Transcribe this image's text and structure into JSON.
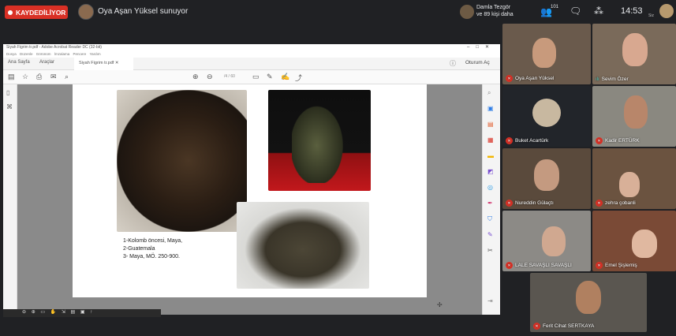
{
  "topbar": {
    "recording_label": "KAYDEDİLİYOR",
    "presenter_text": "Oya Aşan Yüksel sunuyor",
    "viewer_name": "Damla Tezgör",
    "viewer_others": "ve 89 kişi daha",
    "participant_count": "101",
    "clock": "14:53",
    "self_label": "Siz"
  },
  "acrobat": {
    "window_title": "Siyah Figrim tr.pdf - Adobe Acrobat Reader DC (32-bit)",
    "menu": "Dosya Düzenle Görünüm İmzalama Pencere Yardım",
    "tab_home": "Ana Sayfa",
    "tab_tools": "Araçlar",
    "tab_file": "Siyah Figrim tr.pdf",
    "signin": "Oturum Aç",
    "page_indicator": "/4 / 60"
  },
  "slide": {
    "caption_lines": [
      "1-Kolomb öncesi, Maya,",
      "2-Guatemala",
      " 3- Maya, MÖ. 250-900."
    ]
  },
  "participants": [
    {
      "name": "Oya Aşan Yüksel",
      "muted": true,
      "bg": "#6a5a4c",
      "face": "#c89a7c"
    },
    {
      "name": "Sevim Özer",
      "muted": false,
      "bg": "#7a6a5a",
      "face": "#d8a890"
    },
    {
      "name": "Buket Acartürk",
      "muted": true,
      "bg": "#22252a",
      "face": "#c8b8a0"
    },
    {
      "name": "Kadir ERTÜRK",
      "muted": true,
      "bg": "#8a8880",
      "face": "#b8866a"
    },
    {
      "name": "Nureddin Gülaçtı",
      "muted": true,
      "bg": "#5a4a3c",
      "face": "#c49a80"
    },
    {
      "name": "zehra çobanli",
      "muted": true,
      "bg": "#6b5340",
      "face": "#d8b098"
    },
    {
      "name": "LALE SAVAŞLI SAVAŞLI",
      "muted": true,
      "bg": "#8c8a86",
      "face": "#d0a890"
    },
    {
      "name": "Emel Şişlemiş",
      "muted": true,
      "bg": "#7a4a36",
      "face": "#e0b8a0"
    },
    {
      "name": "Ferit Cihat SERTKAYA",
      "muted": true,
      "bg": "#5a5650",
      "face": "#b08060"
    }
  ]
}
